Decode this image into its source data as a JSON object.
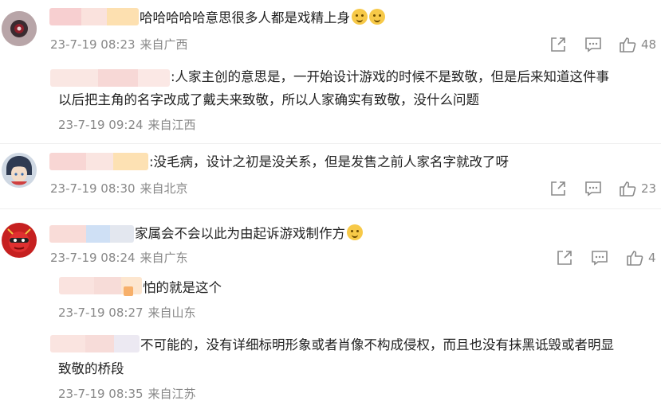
{
  "comments": [
    {
      "text": "哈哈哈哈哈意思很多人都是戏精上身",
      "date": "23-7-19 08:23",
      "location": "来自广西",
      "likes": "48",
      "replies": [
        {
          "text_line1": ":人家主创的意思是，一开始设计游戏的时候不是致敬，但是后来知道这件事",
          "text_line2": "以后把主角的名字改成了戴夫来致敬，所以人家确实有致敬，没什么问题",
          "date": "23-7-19 09:24",
          "location": "来自江西"
        }
      ]
    },
    {
      "text": ":没毛病，设计之初是没关系，但是发售之前人家名字就改了呀",
      "date": "23-7-19 08:30",
      "location": "来自北京",
      "likes": "23"
    },
    {
      "text": "家属会不会以此为由起诉游戏制作方",
      "date": "23-7-19 08:24",
      "location": "来自广东",
      "likes": "4",
      "replies": [
        {
          "text": "怕的就是这个",
          "date": "23-7-19 08:27",
          "location": "来自山东"
        },
        {
          "text_line1": "不可能的，没有详细标明形象或者肖像不构成侵权，而且也没有抹黑诋毁或者明显",
          "text_line2": "致敬的桥段",
          "date": "23-7-19 08:35",
          "location": "来自江苏"
        }
      ]
    }
  ],
  "icons": {
    "share": "share-icon",
    "comment": "comment-icon",
    "like": "thumbs-up-icon",
    "emoji": "emoji-icon"
  },
  "colors": {
    "text": "#222222",
    "meta": "#888888",
    "divider": "#e8e8e8",
    "icon": "#8a8a8a"
  }
}
